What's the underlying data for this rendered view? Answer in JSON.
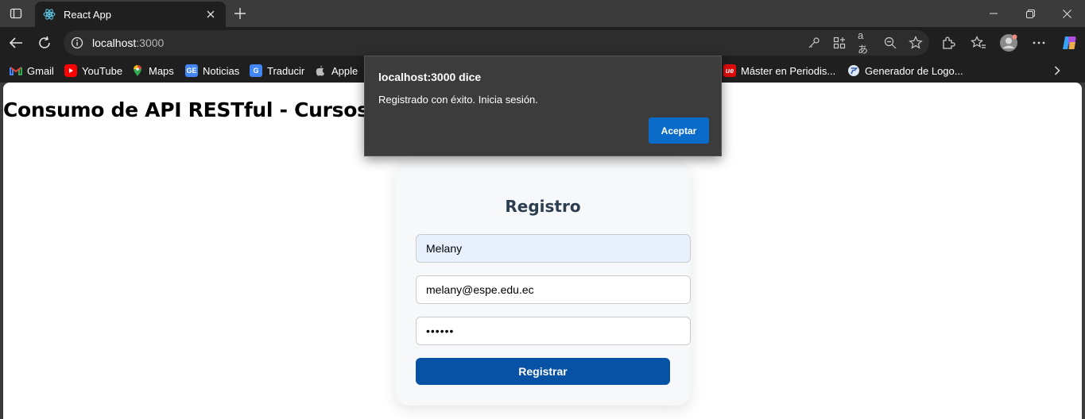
{
  "browser": {
    "tab": {
      "title": "React App"
    },
    "url": {
      "host": "localhost",
      "port": ":3000"
    }
  },
  "bookmarks": [
    {
      "label": "Gmail",
      "icon": "gmail-icon",
      "color": "#ea4335"
    },
    {
      "label": "YouTube",
      "icon": "youtube-icon",
      "color": "#ff0000"
    },
    {
      "label": "Maps",
      "icon": "maps-icon",
      "color": "#34a853"
    },
    {
      "label": "Noticias",
      "icon": "news-icon",
      "color": "#4285f4"
    },
    {
      "label": "Traducir",
      "icon": "translate-icon",
      "color": "#4285f4"
    },
    {
      "label": "Apple",
      "icon": "apple-icon",
      "color": "#aaaaaa"
    },
    {
      "label": "Máster en Periodis...",
      "icon": "ue-icon",
      "color": "#e10a0a"
    },
    {
      "label": "Generador de Logo...",
      "icon": "logo-generator-icon",
      "color": "#5b8def"
    }
  ],
  "page": {
    "heading": "Consumo de API RESTful - Cursos Mor"
  },
  "form": {
    "title": "Registro",
    "name_value": "Melany",
    "email_value": "melany@espe.edu.ec",
    "password_value": "••••••",
    "submit_label": "Registrar"
  },
  "dialog": {
    "title": "localhost:3000 dice",
    "message": "Registrado con éxito. Inicia sesión.",
    "accept_label": "Aceptar"
  },
  "colors": {
    "primary_button": "#0852a6",
    "dialog_button": "#0a6bc8",
    "autofill_bg": "#e8f0fe"
  }
}
